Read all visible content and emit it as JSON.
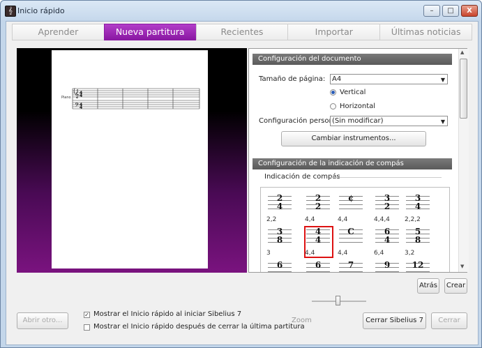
{
  "window": {
    "title": "Inicio rápido",
    "controls": {
      "minimize": "–",
      "maximize": "□",
      "close": "X"
    }
  },
  "tabs": [
    "Aprender",
    "Nueva partitura",
    "Recientes",
    "Importar",
    "Últimas noticias"
  ],
  "active_tab": "Nueva partitura",
  "preview": {
    "instrument_label": "Piano"
  },
  "doc_config": {
    "header": "Configuración del documento",
    "page_size_label": "Tamaño de página:",
    "page_size_value": "A4",
    "orientation_vertical": "Vertical",
    "orientation_horizontal": "Horizontal",
    "orientation_selected": "Vertical",
    "custom_config_label": "Configuración personal",
    "custom_config_value": "(Sin modificar)",
    "change_instruments_button": "Cambiar instrumentos..."
  },
  "time_sig": {
    "header": "Configuración de la indicación de compás",
    "subheader": "Indicación de compás",
    "items": [
      {
        "top": "2",
        "bottom": "4",
        "caption": "2,2"
      },
      {
        "top": "2",
        "bottom": "2",
        "caption": "4,4"
      },
      {
        "top": "¢",
        "bottom": "",
        "caption": "4,4"
      },
      {
        "top": "3",
        "bottom": "2",
        "caption": "4,4,4"
      },
      {
        "top": "3",
        "bottom": "4",
        "caption": "2,2,2"
      },
      {
        "top": "3",
        "bottom": "8",
        "caption": "3"
      },
      {
        "top": "4",
        "bottom": "4",
        "caption": "4,4"
      },
      {
        "top": "C",
        "bottom": "",
        "caption": "4,4"
      },
      {
        "top": "6",
        "bottom": "4",
        "caption": "6,4"
      },
      {
        "top": "5",
        "bottom": "8",
        "caption": "3,2"
      },
      {
        "top": "6",
        "bottom": "",
        "caption": ""
      },
      {
        "top": "6",
        "bottom": "",
        "caption": ""
      },
      {
        "top": "7",
        "bottom": "",
        "caption": ""
      },
      {
        "top": "9",
        "bottom": "",
        "caption": ""
      },
      {
        "top": "12",
        "bottom": "",
        "caption": ""
      }
    ],
    "selected_index": 6
  },
  "buttons": {
    "back": "Atrás",
    "create": "Crear",
    "open_other": "Abrir otro...",
    "close_sibelius": "Cerrar Sibelius 7",
    "close": "Cerrar"
  },
  "checkboxes": {
    "show_on_start": {
      "label": "Mostrar el Inicio rápido al iniciar Sibelius 7",
      "checked": true
    },
    "show_after_close": {
      "label": "Mostrar el Inicio rápido después de cerrar la última partitura",
      "checked": false
    }
  },
  "zoom": {
    "label": "Zoom"
  }
}
